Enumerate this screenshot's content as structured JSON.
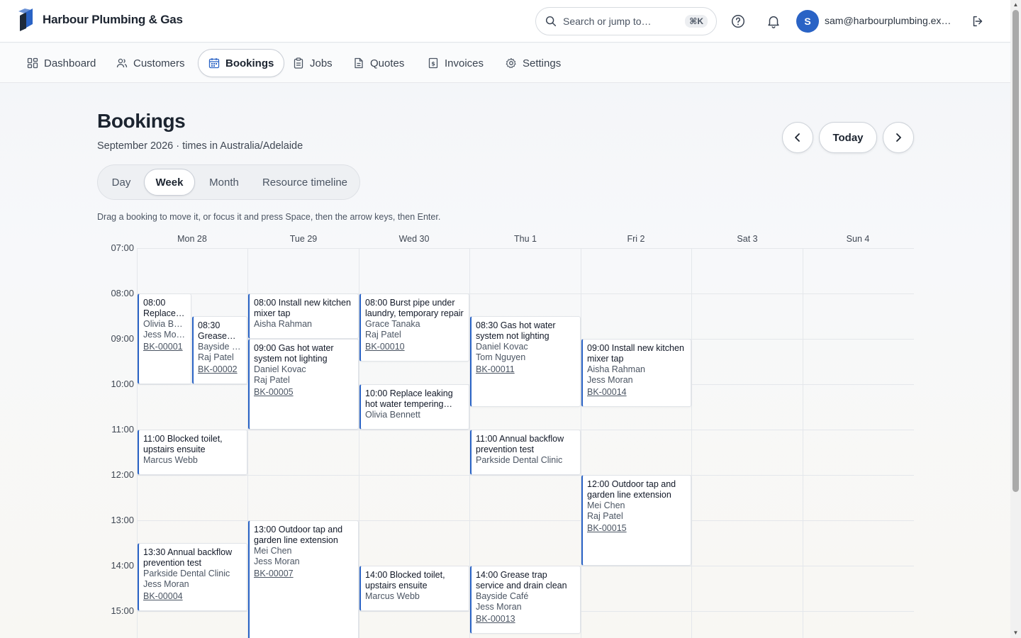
{
  "brand": {
    "name": "Harbour Plumbing & Gas",
    "logo_icon": "brand-logo-icon",
    "accent": "#2a63c5"
  },
  "header": {
    "search_placeholder": "Search or jump to…",
    "search_shortcut": "⌘K",
    "help_icon": "help-circle-icon",
    "notifications_icon": "bell-icon",
    "avatar_initial": "S",
    "user_email": "sam@harbourplumbing.ex…",
    "logout_icon": "logout-icon"
  },
  "nav": {
    "items": [
      {
        "label": "Dashboard",
        "icon": "dashboard-icon"
      },
      {
        "label": "Customers",
        "icon": "users-icon"
      },
      {
        "label": "Bookings",
        "icon": "calendar-icon",
        "active": true
      },
      {
        "label": "Jobs",
        "icon": "clipboard-icon"
      },
      {
        "label": "Quotes",
        "icon": "document-icon"
      },
      {
        "label": "Invoices",
        "icon": "invoice-icon"
      },
      {
        "label": "Settings",
        "icon": "gear-icon"
      }
    ]
  },
  "page": {
    "title": "Bookings",
    "subtitle": "September 2026 · times in Australia/Adelaide",
    "prev_icon": "chevron-left-icon",
    "today_label": "Today",
    "next_icon": "chevron-right-icon",
    "views": [
      "Day",
      "Week",
      "Month",
      "Resource timeline"
    ],
    "active_view": "Week",
    "hint": "Drag a booking to move it, or focus it and press Space, then the arrow keys, then Enter."
  },
  "calendar": {
    "days": [
      "Mon 28",
      "Tue 29",
      "Wed 30",
      "Thu 1",
      "Fri 2",
      "Sat 3",
      "Sun 4"
    ],
    "hours": [
      "07:00",
      "08:00",
      "09:00",
      "10:00",
      "11:00",
      "12:00",
      "13:00",
      "14:00",
      "15:00"
    ],
    "events": [
      {
        "title": "08:00 Replace…",
        "customer": "Olivia Ben…",
        "staff": "Jess Mora…",
        "ref": "BK-00001"
      },
      {
        "title": "08:30 Grease…",
        "customer": "Bayside C…",
        "staff": "Raj Patel",
        "ref": "BK-00002"
      },
      {
        "title": "11:00 Blocked toilet, upstairs ensuite",
        "customer": "Marcus Webb"
      },
      {
        "title": "13:30 Annual backflow prevention test",
        "customer": "Parkside Dental Clinic",
        "staff": "Jess Moran",
        "ref": "BK-00004"
      },
      {
        "title": "08:00 Install new kitchen mixer tap",
        "customer": "Aisha Rahman"
      },
      {
        "title": "09:00 Gas hot water system not lighting",
        "customer": "Daniel Kovac",
        "staff": "Raj Patel",
        "ref": "BK-00005"
      },
      {
        "title": "13:00 Outdoor tap and garden line extension",
        "customer": "Mei Chen",
        "staff": "Jess Moran",
        "ref": "BK-00007"
      },
      {
        "title": "08:00 Burst pipe under laundry, temporary repair",
        "customer": "Grace Tanaka",
        "staff": "Raj Patel",
        "ref": "BK-00010"
      },
      {
        "title": "10:00 Replace leaking hot water tempering…",
        "customer": "Olivia Bennett"
      },
      {
        "title": "14:00 Blocked toilet, upstairs ensuite",
        "customer": "Marcus Webb"
      },
      {
        "title": "08:30 Gas hot water system not lighting",
        "customer": "Daniel Kovac",
        "staff": "Tom Nguyen",
        "ref": "BK-00011"
      },
      {
        "title": "11:00 Annual backflow prevention test",
        "customer": "Parkside Dental Clinic"
      },
      {
        "title": "14:00 Grease trap service and drain clean",
        "customer": "Bayside Café",
        "staff": "Jess Moran",
        "ref": "BK-00013"
      },
      {
        "title": "09:00 Install new kitchen mixer tap",
        "customer": "Aisha Rahman",
        "staff": "Jess Moran",
        "ref": "BK-00014"
      },
      {
        "title": "12:00 Outdoor tap and garden line extension",
        "customer": "Mei Chen",
        "staff": "Raj Patel",
        "ref": "BK-00015"
      }
    ]
  }
}
